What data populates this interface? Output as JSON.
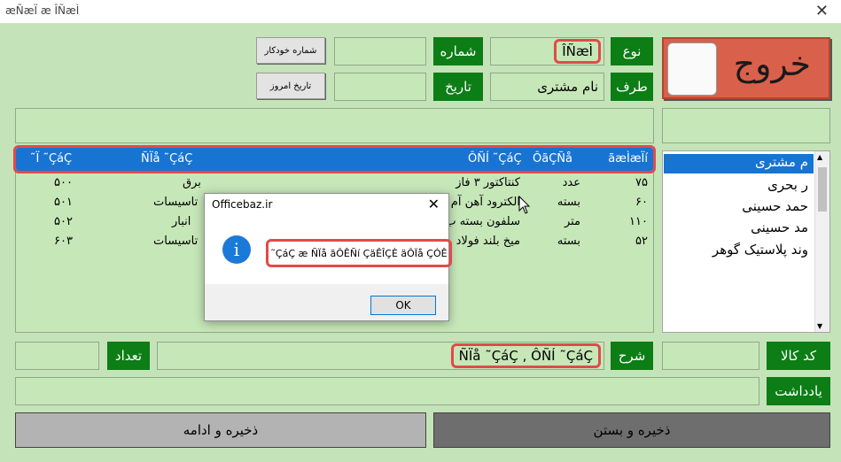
{
  "window": {
    "title": "æÑæÏ æ ÎÑæÌ",
    "close_glyph": "✕"
  },
  "exit_button": {
    "label": "خروج"
  },
  "header": {
    "type_label": "نوع",
    "type_value": "ÎÑæÌ",
    "side_label": "طرف",
    "side_value": "نام مشتری",
    "number_label": "شماره",
    "number_value": "",
    "date_label": "تاریخ",
    "date_value": "",
    "auto_number_button": "شماره خودکار",
    "today_date_button": "تاریخ امروز"
  },
  "grid": {
    "columns": [
      "ãæÌæÏí",
      "ÔãÇÑå",
      "ÔÑÍ ˜ÇáÇ",
      "ÑÏå ˜ÇáÇ",
      "˜Ï ˜ÇáÇ"
    ],
    "rows": [
      {
        "stock": "۷۵",
        "unit": "عدد",
        "desc": "کنتاکتور ۳ فاز",
        "group": "برق",
        "code": "۵۰۰"
      },
      {
        "stock": "۶۰",
        "unit": "بسته",
        "desc": "الکترود آهن آم",
        "group": "تاسیسات",
        "code": "۵۰۱"
      },
      {
        "stock": "۱۱۰",
        "unit": "متر",
        "desc": "سلفون بسته ب",
        "group": "انبار",
        "code": "۵۰۲"
      },
      {
        "stock": "۵۲",
        "unit": "بسته",
        "desc": "میخ بلند فولاد",
        "group": "تاسیسات",
        "code": "۶۰۳"
      }
    ]
  },
  "customer_list": {
    "items": [
      "م مشتری",
      "ر بحری",
      "حمد حسینی",
      "مد حسینی",
      "وند پلاستیک گوهر"
    ],
    "selected_index": 0
  },
  "footer_fields": {
    "description_label": "شرح",
    "description_value": "ÑÏå ˜ÇáÇ , ÔÑÍ ˜ÇáÇ",
    "quantity_label": "تعداد",
    "code_label": "کد کالا",
    "note_label": "یادداشت"
  },
  "buttons": {
    "save_continue": "ذخیره و ادامه",
    "save_close": "ذخیره و بستن"
  },
  "dialog": {
    "title": "Officebaz.ir",
    "close_glyph": "✕",
    "icon_glyph": "i",
    "message": "˜ÇáÇ æ ÑÏå ãÔÊÑí ÇäÊÎÇÈ äÔÏå ÇÓÊ",
    "ok": "OK"
  },
  "colors": {
    "accent_green": "#0d7d16",
    "selection_blue": "#1874d2",
    "exit_red": "#d9604a",
    "highlight_red": "#e24a4a"
  }
}
